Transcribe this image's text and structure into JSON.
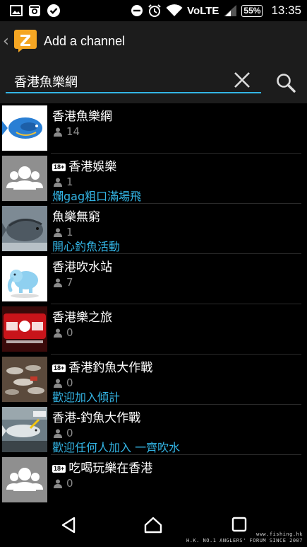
{
  "status_bar": {
    "time": "13:35",
    "battery": "55%",
    "network": "VoLTE"
  },
  "action_bar": {
    "title": "Add a channel"
  },
  "search": {
    "value": "香港魚樂網"
  },
  "channels": [
    {
      "name": "香港魚樂網",
      "members": "14",
      "adult": false,
      "description": ""
    },
    {
      "name": "香港娛樂",
      "members": "1",
      "adult": true,
      "description": "爛gag粗口滿場飛"
    },
    {
      "name": "魚樂無窮",
      "members": "1",
      "adult": false,
      "description": "開心釣魚活動"
    },
    {
      "name": "香港吹水站",
      "members": "7",
      "adult": false,
      "description": ""
    },
    {
      "name": "香港樂之旅",
      "members": "0",
      "adult": false,
      "description": ""
    },
    {
      "name": "香港釣魚大作戰",
      "members": "0",
      "adult": true,
      "description": "歡迎加入傾計"
    },
    {
      "name": "香港-釣魚大作戰",
      "members": "0",
      "adult": false,
      "description": "歡迎任何人加入 一齊吹水"
    },
    {
      "name": "吃喝玩樂在香港",
      "members": "0",
      "adult": true,
      "description": ""
    }
  ],
  "badge_label": "18+",
  "watermark": {
    "line1": "www.fishing.hk",
    "line2": "H.K. NO.1 ANGLERS' FORUM SINCE 2007"
  },
  "colors": {
    "accent": "#33b5e5",
    "app_brand": "#f5a623",
    "background": "#000000",
    "bar": "#1c1c1c"
  }
}
